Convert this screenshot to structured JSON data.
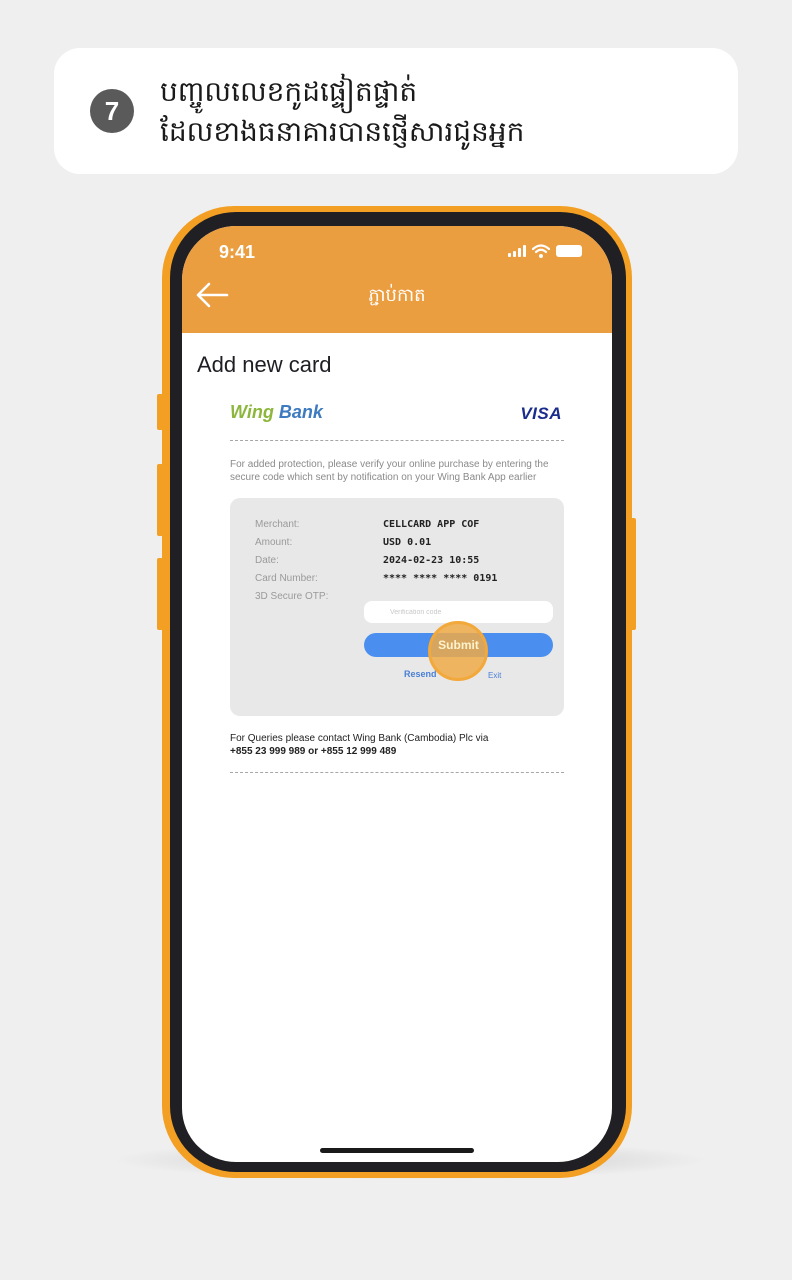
{
  "step": {
    "number": "7",
    "line1": "បញ្ចូលលេខកូដផ្ទៀតផ្ទាត់",
    "line2": "ដែលខាងធនាគារបានផ្ញើសារជូនអ្នក"
  },
  "status_bar": {
    "time": "9:41",
    "icons": [
      "signal-icon",
      "wifi-icon",
      "battery-icon"
    ]
  },
  "header": {
    "title": "ភ្ជាប់កាត",
    "back_icon": "back-arrow-icon",
    "color": "#eb9e40"
  },
  "page": {
    "title": "Add new card"
  },
  "card_form": {
    "bank_logo_part1": "Wing",
    "bank_logo_part2": " Bank",
    "network_logo": "VISA",
    "protection_text": "For added protection, please verify your online purchase by entering the secure code which sent by notification on your Wing Bank App earlier",
    "fields": [
      {
        "label": "Merchant:",
        "value": "CELLCARD APP COF"
      },
      {
        "label": "Amount:",
        "value": "USD 0.01"
      },
      {
        "label": "Date:",
        "value": "2024-02-23 10:55"
      },
      {
        "label": "Card Number:",
        "value": "**** **** **** 0191"
      }
    ],
    "otp_label": "3D Secure OTP:",
    "otp_placeholder": "Verification code",
    "otp_value": "",
    "submit_label": "Submit",
    "resend_label": "Resend",
    "exit_label": "Exit",
    "contact_line1": "For Queries please contact Wing Bank (Cambodia) Plc via",
    "contact_line2": "+855 23 999 989 or +855 12 999 489"
  },
  "colors": {
    "phone_frame": "#f29f24",
    "submit_button": "#4a8fef",
    "tap_highlight": "#f2a83a"
  }
}
